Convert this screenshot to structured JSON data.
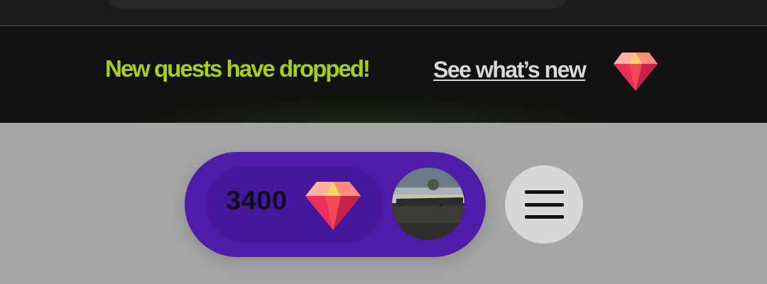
{
  "banner": {
    "message": "New quests have dropped!",
    "link_label": "See what’s new",
    "gem_icon": "gem-icon",
    "message_color": "#a6cf1d"
  },
  "user_pill": {
    "points": "3400",
    "gem_icon": "gem-icon",
    "avatar": "user-avatar",
    "background_color": "#4e1ca8"
  },
  "menu": {
    "icon": "hamburger-menu-icon"
  }
}
